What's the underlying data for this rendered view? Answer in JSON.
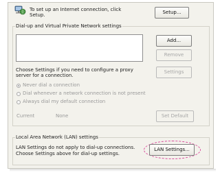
{
  "setup_section": {
    "text_line1": "To set up an Internet connection, click",
    "text_line2": "Setup.",
    "setup_button": "Setup..."
  },
  "dialup_group": {
    "title": "Dial-up and Virtual Private Network settings",
    "add_button": "Add...",
    "remove_button": "Remove",
    "settings_button": "Settings",
    "choose_line1": "Choose Settings if you need to configure a proxy",
    "choose_line2": "server for a connection.",
    "radios": [
      {
        "label": "Never dial a connection",
        "checked": true
      },
      {
        "label": "Dial whenever a network connection is not present",
        "checked": false
      },
      {
        "label": "Always dial my default connection",
        "checked": false
      }
    ],
    "current_label": "Current",
    "current_value": "None",
    "set_default_button": "Set Default"
  },
  "lan_group": {
    "title": "Local Area Network (LAN) settings",
    "line1": "LAN Settings do not apply to dial-up connections.",
    "line2": "Choose Settings above for dial-up settings.",
    "lan_settings_button": "LAN Settings...",
    "highlight_color": "#d9459a"
  },
  "icons": {
    "connection": "network-globe-icon"
  }
}
